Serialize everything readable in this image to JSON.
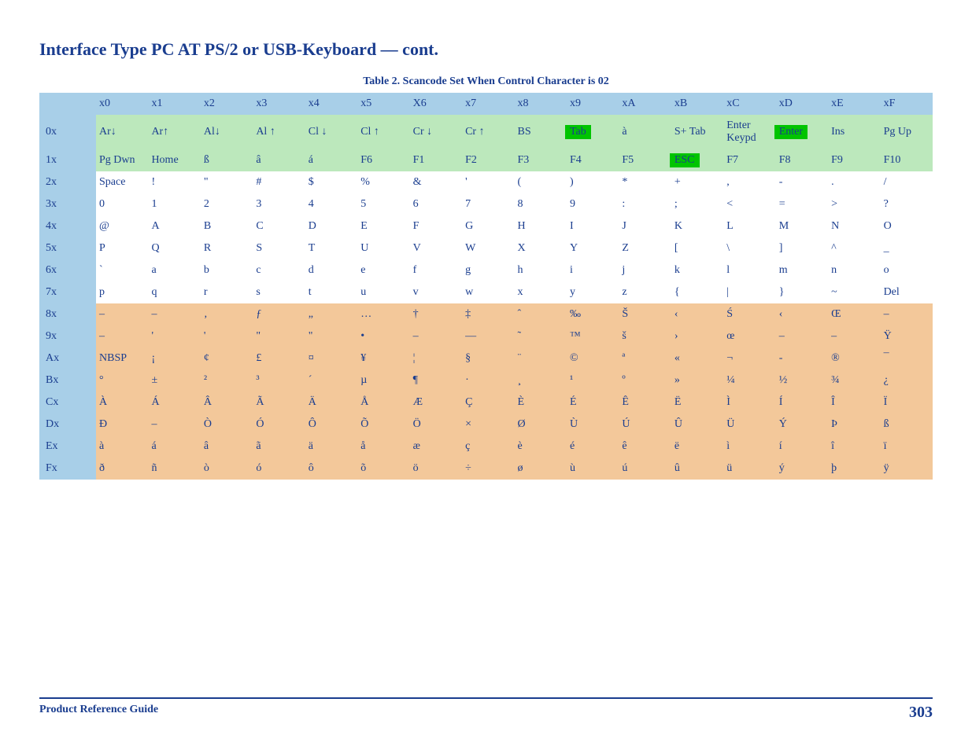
{
  "title": "Interface Type PC AT PS/2 or USB-Keyboard — cont.",
  "table_caption": "Table 2. Scancode Set When Control Character is 02",
  "columns": [
    "",
    "x0",
    "x1",
    "x2",
    "x3",
    "x4",
    "x5",
    "X6",
    "x7",
    "x8",
    "x9",
    "xA",
    "xB",
    "xC",
    "xD",
    "xE",
    "xF"
  ],
  "rows": [
    {
      "idx": "0x",
      "cls": "green",
      "cells": [
        "Ar↓",
        "Ar↑",
        "Al↓",
        "Al ↑",
        "Cl ↓",
        "Cl ↑",
        "Cr ↓",
        "Cr ↑",
        "BS",
        "Tab",
        "à",
        "S+ Tab",
        "Enter Keypd",
        "Enter",
        "Ins",
        "Pg Up"
      ],
      "hl": [
        9,
        13
      ]
    },
    {
      "idx": "1x",
      "cls": "green",
      "cells": [
        "Pg Dwn",
        "Home",
        "ß",
        "â",
        "á",
        "F6",
        "F1",
        "F2",
        "F3",
        "F4",
        "F5",
        "ESC",
        "F7",
        "F8",
        "F9",
        "F10"
      ],
      "hl": [
        11
      ]
    },
    {
      "idx": "2x",
      "cls": "white",
      "cells": [
        "Space",
        "!",
        "\"",
        "#",
        "$",
        "%",
        "&",
        "'",
        "(",
        ")",
        "*",
        "+",
        ",",
        "-",
        ".",
        "/"
      ]
    },
    {
      "idx": "3x",
      "cls": "white",
      "cells": [
        "0",
        "1",
        "2",
        "3",
        "4",
        "5",
        "6",
        "7",
        "8",
        "9",
        ":",
        ";",
        "<",
        "=",
        ">",
        "?"
      ]
    },
    {
      "idx": "4x",
      "cls": "white",
      "cells": [
        "@",
        "A",
        "B",
        "C",
        "D",
        "E",
        "F",
        "G",
        "H",
        "I",
        "J",
        "K",
        "L",
        "M",
        "N",
        "O"
      ]
    },
    {
      "idx": "5x",
      "cls": "white",
      "cells": [
        "P",
        "Q",
        "R",
        "S",
        "T",
        "U",
        "V",
        "W",
        "X",
        "Y",
        "Z",
        "[",
        "\\",
        "]",
        "^",
        "_"
      ]
    },
    {
      "idx": "6x",
      "cls": "white",
      "cells": [
        "`",
        "a",
        "b",
        "c",
        "d",
        "e",
        "f",
        "g",
        "h",
        "i",
        "j",
        "k",
        "l",
        "m",
        "n",
        "o"
      ]
    },
    {
      "idx": "7x",
      "cls": "white",
      "cells": [
        "p",
        "q",
        "r",
        "s",
        "t",
        "u",
        "v",
        "w",
        "x",
        "y",
        "z",
        "{",
        "|",
        "}",
        "~",
        "Del"
      ]
    },
    {
      "idx": "8x",
      "cls": "tan",
      "cells": [
        "–",
        "–",
        "‚",
        "ƒ",
        "„",
        "…",
        "†",
        "‡",
        "ˆ",
        "‰",
        "Š",
        "‹",
        "Ś",
        "‹",
        "Œ",
        "–"
      ]
    },
    {
      "idx": "9x",
      "cls": "tan",
      "cells": [
        "–",
        "'",
        "'",
        "\"",
        "\"",
        "•",
        "–",
        "—",
        "˜",
        "™",
        "š",
        "›",
        "œ",
        "–",
        "–",
        "Ÿ"
      ]
    },
    {
      "idx": "Ax",
      "cls": "tan",
      "cells": [
        "NBSP",
        "¡",
        "¢",
        "£",
        "¤",
        "¥",
        "¦",
        "§",
        "¨",
        "©",
        "ª",
        "«",
        "¬",
        "-",
        "®",
        "¯"
      ]
    },
    {
      "idx": "Bx",
      "cls": "tan",
      "cells": [
        "°",
        "±",
        "²",
        "³",
        "´",
        "µ",
        "¶",
        "·",
        "¸",
        "¹",
        "º",
        "»",
        "¼",
        "½",
        "¾",
        "¿"
      ]
    },
    {
      "idx": "Cx",
      "cls": "tan",
      "cells": [
        "À",
        "Á",
        "Â",
        "Ã",
        "Ä",
        "Å",
        "Æ",
        "Ç",
        "È",
        "É",
        "Ê",
        "Ë",
        "Ì",
        "Í",
        "Î",
        "Ï"
      ]
    },
    {
      "idx": "Dx",
      "cls": "tan",
      "cells": [
        "Ð",
        "–",
        "Ò",
        "Ó",
        "Ô",
        "Õ",
        "Ö",
        "×",
        "Ø",
        "Ù",
        "Ú",
        "Û",
        "Ü",
        "Ý",
        "Þ",
        "ß"
      ]
    },
    {
      "idx": "Ex",
      "cls": "tan",
      "cells": [
        "à",
        "á",
        "â",
        "ã",
        "ä",
        "å",
        "æ",
        "ç",
        "è",
        "é",
        "ê",
        "ë",
        "ì",
        "í",
        "î",
        "ï"
      ]
    },
    {
      "idx": "Fx",
      "cls": "tan",
      "cells": [
        "ð",
        "ñ",
        "ò",
        "ó",
        "ô",
        "õ",
        "ö",
        "÷",
        "ø",
        "ù",
        "ú",
        "û",
        "ü",
        "ý",
        "þ",
        "ÿ"
      ]
    }
  ],
  "footer": {
    "guide": "Product Reference Guide",
    "page": "303"
  }
}
